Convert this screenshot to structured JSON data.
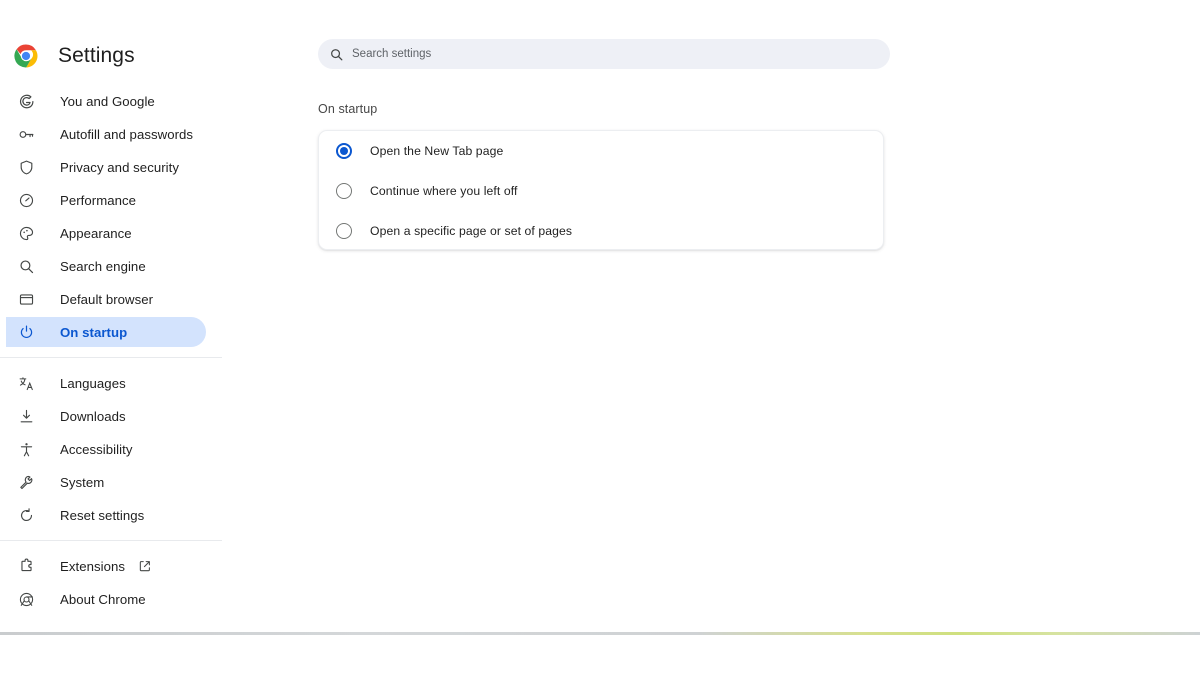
{
  "brand": {
    "title": "Settings",
    "logo_icon": "chrome-logo-icon",
    "colors": {
      "chrome_red": "#EA4335",
      "chrome_yellow": "#FBBC05",
      "chrome_green": "#34A853",
      "chrome_blue": "#4285F4"
    }
  },
  "accent_color": "#0b57d0",
  "active_pill_color": "#d3e3fd",
  "sidebar": {
    "groups": [
      {
        "items": [
          {
            "label": "You and Google",
            "icon": "google-g-icon",
            "active": false
          },
          {
            "label": "Autofill and passwords",
            "icon": "key-icon",
            "active": false
          },
          {
            "label": "Privacy and security",
            "icon": "shield-icon",
            "active": false
          },
          {
            "label": "Performance",
            "icon": "speedometer-icon",
            "active": false
          },
          {
            "label": "Appearance",
            "icon": "palette-icon",
            "active": false
          },
          {
            "label": "Search engine",
            "icon": "search-icon",
            "active": false
          },
          {
            "label": "Default browser",
            "icon": "browser-window-icon",
            "active": false
          },
          {
            "label": "On startup",
            "icon": "power-icon",
            "active": true
          }
        ]
      },
      {
        "items": [
          {
            "label": "Languages",
            "icon": "translate-icon",
            "active": false
          },
          {
            "label": "Downloads",
            "icon": "download-icon",
            "active": false
          },
          {
            "label": "Accessibility",
            "icon": "accessibility-person-icon",
            "active": false
          },
          {
            "label": "System",
            "icon": "wrench-icon",
            "active": false
          },
          {
            "label": "Reset settings",
            "icon": "refresh-restore-icon",
            "active": false
          }
        ]
      },
      {
        "items": [
          {
            "label": "Extensions",
            "icon": "puzzle-piece-icon",
            "active": false,
            "external": true,
            "external_icon": "external-link-icon"
          },
          {
            "label": "About Chrome",
            "icon": "chrome-outline-icon",
            "active": false
          }
        ]
      }
    ]
  },
  "search": {
    "placeholder": "Search settings",
    "value": "",
    "icon": "search-icon"
  },
  "main": {
    "section_title": "On startup",
    "startup_options": [
      {
        "label": "Open the New Tab page",
        "selected": true
      },
      {
        "label": "Continue where you left off",
        "selected": false
      },
      {
        "label": "Open a specific page or set of pages",
        "selected": false
      }
    ]
  }
}
